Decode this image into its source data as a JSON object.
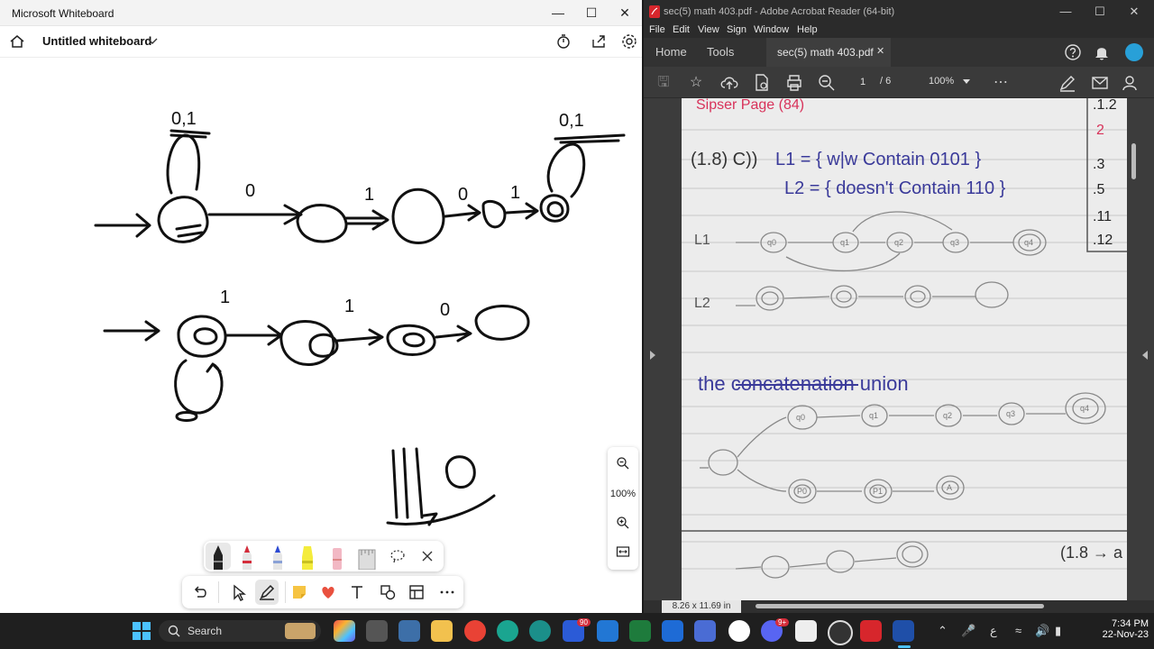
{
  "whiteboard": {
    "window_title": "Microsoft Whiteboard",
    "board_name": "Untitled whiteboard",
    "zoom": "100%",
    "sketch_labels": {
      "a": "0,1",
      "b": "0",
      "c": "1",
      "d": "0",
      "e": "1",
      "f": "0,1",
      "g": "1",
      "h": "1",
      "i": "0",
      "j": "110"
    }
  },
  "acrobat": {
    "window_title": "sec(5) math 403.pdf - Adobe Acrobat Reader (64-bit)",
    "menu": [
      "File",
      "Edit",
      "View",
      "Sign",
      "Window",
      "Help"
    ],
    "tabs": {
      "home": "Home",
      "tools": "Tools",
      "doc": "sec(5) math 403.pdf"
    },
    "page_current": "1",
    "page_total": "/ 6",
    "zoom": "100%",
    "page_size": "8.26 x 11.69 in",
    "notes": {
      "header": "Sipser Page (84)",
      "problem": "(1.8) C))",
      "l1": "L1 = { w|w Contain 0101 }",
      "l2": "L2 = { doesn't Contain 110 }",
      "row1": "L1",
      "row2": "L2",
      "union_title": "the concatenation union",
      "next": "(1.8 → a",
      "states_l1": [
        "q0",
        "q1",
        "q2",
        "q3",
        "q4"
      ],
      "states_union": [
        "q0",
        "q1",
        "q2",
        "q3",
        "q4"
      ],
      "states_l2": [
        "P0",
        "P1",
        "A"
      ],
      "side_list": [
        ".1.2",
        "2",
        ".3",
        ".5",
        ".11",
        ".12"
      ]
    }
  },
  "taskbar": {
    "search_label": "Search",
    "time": "7:34 PM",
    "date": "22-Nov-23",
    "lang": "ع",
    "badges": {
      "edge": "90",
      "discord": "9+"
    }
  },
  "colors": {
    "acrobat_red": "#d7262c",
    "note_blue": "#3a3a9a",
    "note_red": "#d8325a"
  }
}
